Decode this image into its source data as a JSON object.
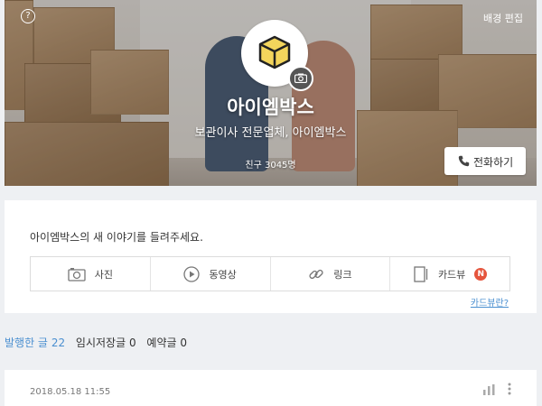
{
  "cover": {
    "edit_background_label": "배경 편집",
    "help_icon_glyph": "?"
  },
  "profile": {
    "channel_name": "아이엠박스",
    "description": "보관이사 전문업체, 아이엠박스",
    "friends_label": "친구",
    "friends_count": "3045명",
    "call_button_label": "전화하기"
  },
  "compose": {
    "prompt": "아이엠박스의 새 이야기를 들려주세요.",
    "actions": [
      {
        "label": "사진",
        "icon": "camera-icon"
      },
      {
        "label": "동영상",
        "icon": "play-icon"
      },
      {
        "label": "링크",
        "icon": "link-icon"
      },
      {
        "label": "카드뷰",
        "icon": "cardview-icon",
        "badge": "N"
      }
    ],
    "cardview_link": "카드뷰란?"
  },
  "tabs": [
    {
      "label": "발행한 글",
      "count": "22",
      "active": true
    },
    {
      "label": "임시저장글",
      "count": "0",
      "active": false
    },
    {
      "label": "예약글",
      "count": "0",
      "active": false
    }
  ],
  "post": {
    "date": "2018.05.18 11:55"
  },
  "colors": {
    "accent": "#4a8fd0",
    "badge": "#e5553d",
    "background": "#eef0f3"
  }
}
